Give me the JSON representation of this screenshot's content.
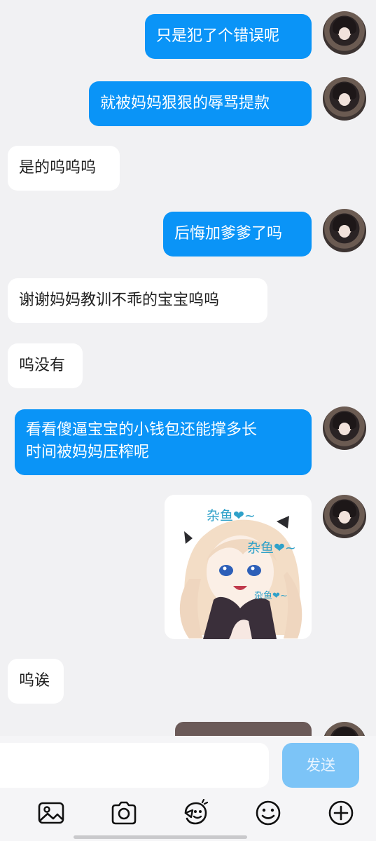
{
  "messages": [
    {
      "dir": "out",
      "text": "只是犯了个错误呢"
    },
    {
      "dir": "out",
      "text": "就被妈妈狠狠的辱骂提款"
    },
    {
      "dir": "in",
      "text": "是的呜呜呜"
    },
    {
      "dir": "out",
      "text": "后悔加爹爹了吗"
    },
    {
      "dir": "in",
      "text": "谢谢妈妈教训不乖的宝宝呜呜"
    },
    {
      "dir": "in",
      "text": "呜没有"
    },
    {
      "dir": "out",
      "text_line1": "看看傻逼宝宝的小钱包还能撑多长",
      "text_line2": "时间被妈妈压榨呢"
    },
    {
      "dir": "out",
      "type": "sticker",
      "sticker_text": [
        "杂鱼❤~",
        "杂鱼❤~",
        "杂鱼❤~"
      ]
    },
    {
      "dir": "in",
      "text": "呜诶"
    }
  ],
  "input": {
    "placeholder": "",
    "send_label": "发送"
  },
  "toolbar": {
    "icons": [
      "image-icon",
      "camera-icon",
      "sticker-face-icon",
      "emoji-icon",
      "plus-icon"
    ]
  },
  "colors": {
    "outgoing_bubble": "#0a94f7",
    "incoming_bubble": "#ffffff",
    "background": "#f1f1f3",
    "send_button": "#7cc4f7"
  }
}
